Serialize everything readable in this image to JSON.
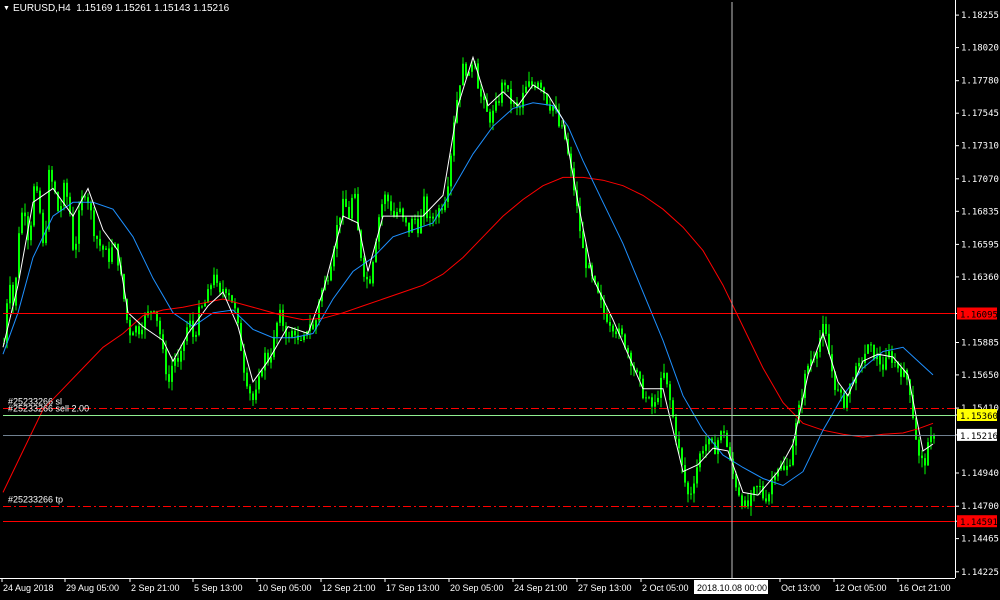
{
  "header": {
    "symbol": "EURUSD,H4",
    "ohlc": "1.15169 1.15261 1.15143 1.15216",
    "menu_icon": "triangle-down-icon"
  },
  "chart_data": {
    "type": "candlestick",
    "title": "EURUSD,H4",
    "ylim": [
      1.1418,
      1.1835
    ],
    "y_ticks": [
      "1.18255",
      "1.18020",
      "1.17780",
      "1.17545",
      "1.17310",
      "1.17070",
      "1.16835",
      "1.16595",
      "1.16360",
      "1.16095",
      "1.15885",
      "1.15650",
      "1.15410",
      "1.15360",
      "1.15216",
      "1.14940",
      "1.14700",
      "1.14591",
      "1.14465",
      "1.14225"
    ],
    "x_ticks": [
      "24 Aug 2018",
      "29 Aug 05:00",
      "2 Sep 21:00",
      "5 Sep 13:00",
      "10 Sep 05:00",
      "12 Sep 21:00",
      "17 Sep 13:00",
      "20 Sep 05:00",
      "24 Sep 21:00",
      "27 Sep 13:00",
      "2 Oct 05:00",
      "2018.10.08 00:00",
      "Oct 13:00",
      "12 Oct 05:00",
      "16 Oct 21:00"
    ],
    "crosshair_time": "2018.10.08 00:00",
    "grid": false,
    "colors": {
      "background": "#000000",
      "candle": "#00ff00",
      "fast_ma": "#ffffff",
      "mid_ma": "#1e90ff",
      "slow_ma": "#ff0000",
      "level_line": "#ff0000",
      "order_line": "#90ee90",
      "price_label_red": "#ff0000",
      "price_label_yellow": "#ffff00",
      "current_price_label": "#ffffff"
    },
    "horizontal_levels": [
      {
        "name": "resistance",
        "price": 1.16095,
        "style": "solid",
        "color": "#ff0000",
        "label": "1.16095"
      },
      {
        "name": "stop-loss",
        "price": 1.1541,
        "style": "dashdot",
        "color": "#ff0000",
        "text": "#25233266 sl"
      },
      {
        "name": "open-order",
        "price": 1.1536,
        "style": "solid",
        "color": "#90ee90",
        "text": "#25233266 sell 2.00",
        "label": "1.15360"
      },
      {
        "name": "current-price",
        "price": 1.15216,
        "style": "solid",
        "color": "#708090",
        "label": "1.15216"
      },
      {
        "name": "take-profit",
        "price": 1.147,
        "style": "dashdot",
        "color": "#ff0000",
        "text": "#25233266 tp"
      },
      {
        "name": "support",
        "price": 1.14591,
        "style": "solid",
        "color": "#ff0000",
        "label": "1.14591"
      }
    ],
    "close_path": [
      [
        0,
        1.1588
      ],
      [
        5,
        1.164
      ],
      [
        10,
        1.161
      ],
      [
        15,
        1.167
      ],
      [
        20,
        1.169
      ],
      [
        25,
        1.166
      ],
      [
        30,
        1.17
      ],
      [
        35,
        1.169
      ],
      [
        40,
        1.165
      ],
      [
        45,
        1.171
      ],
      [
        50,
        1.17
      ],
      [
        55,
        1.168
      ],
      [
        60,
        1.17
      ],
      [
        65,
        1.169
      ],
      [
        70,
        1.165
      ],
      [
        75,
        1.168
      ],
      [
        80,
        1.17
      ],
      [
        85,
        1.169
      ],
      [
        90,
        1.167
      ],
      [
        95,
        1.166
      ],
      [
        100,
        1.1655
      ],
      [
        105,
        1.165
      ],
      [
        110,
        1.166
      ],
      [
        115,
        1.1645
      ],
      [
        120,
        1.162
      ],
      [
        125,
        1.1595
      ],
      [
        130,
        1.16
      ],
      [
        135,
        1.1598
      ],
      [
        140,
        1.1605
      ],
      [
        145,
        1.161
      ],
      [
        150,
        1.1615
      ],
      [
        155,
        1.16
      ],
      [
        160,
        1.1575
      ],
      [
        165,
        1.156
      ],
      [
        170,
        1.158
      ],
      [
        175,
        1.157
      ],
      [
        180,
        1.159
      ],
      [
        185,
        1.1605
      ],
      [
        190,
        1.159
      ],
      [
        195,
        1.161
      ],
      [
        200,
        1.1615
      ],
      [
        205,
        1.1625
      ],
      [
        210,
        1.164
      ],
      [
        215,
        1.162
      ],
      [
        220,
        1.163
      ],
      [
        225,
        1.1625
      ],
      [
        230,
        1.1615
      ],
      [
        235,
        1.1595
      ],
      [
        240,
        1.157
      ],
      [
        245,
        1.1555
      ],
      [
        250,
        1.1545
      ],
      [
        255,
        1.156
      ],
      [
        260,
        1.158
      ],
      [
        265,
        1.1575
      ],
      [
        270,
        1.159
      ],
      [
        275,
        1.161
      ],
      [
        280,
        1.16
      ],
      [
        285,
        1.159
      ],
      [
        290,
        1.16
      ],
      [
        295,
        1.1585
      ],
      [
        300,
        1.159
      ],
      [
        305,
        1.1605
      ],
      [
        310,
        1.1595
      ],
      [
        315,
        1.162
      ],
      [
        320,
        1.163
      ],
      [
        325,
        1.164
      ],
      [
        330,
        1.166
      ],
      [
        335,
        1.168
      ],
      [
        340,
        1.169
      ],
      [
        345,
        1.168
      ],
      [
        350,
        1.17
      ],
      [
        355,
        1.166
      ],
      [
        360,
        1.164
      ],
      [
        365,
        1.163
      ],
      [
        370,
        1.1655
      ],
      [
        375,
        1.168
      ],
      [
        380,
        1.1695
      ],
      [
        385,
        1.169
      ],
      [
        390,
        1.168
      ],
      [
        395,
        1.1685
      ],
      [
        400,
        1.1675
      ],
      [
        405,
        1.167
      ],
      [
        410,
        1.168
      ],
      [
        415,
        1.167
      ],
      [
        420,
        1.169
      ],
      [
        425,
        1.1675
      ],
      [
        430,
        1.168
      ],
      [
        435,
        1.1685
      ],
      [
        440,
        1.169
      ],
      [
        445,
        1.171
      ],
      [
        450,
        1.175
      ],
      [
        455,
        1.1775
      ],
      [
        460,
        1.179
      ],
      [
        465,
        1.178
      ],
      [
        470,
        1.18
      ],
      [
        475,
        1.177
      ],
      [
        480,
        1.176
      ],
      [
        485,
        1.175
      ],
      [
        490,
        1.1755
      ],
      [
        495,
        1.1765
      ],
      [
        500,
        1.178
      ],
      [
        505,
        1.1765
      ],
      [
        510,
        1.176
      ],
      [
        515,
        1.1755
      ],
      [
        520,
        1.177
      ],
      [
        525,
        1.1775
      ],
      [
        530,
        1.1775
      ],
      [
        535,
        1.178
      ],
      [
        540,
        1.177
      ],
      [
        545,
        1.176
      ],
      [
        550,
        1.176
      ],
      [
        555,
        1.1745
      ],
      [
        560,
        1.174
      ],
      [
        565,
        1.172
      ],
      [
        570,
        1.17
      ],
      [
        575,
        1.1675
      ],
      [
        580,
        1.165
      ],
      [
        585,
        1.164
      ],
      [
        590,
        1.163
      ],
      [
        595,
        1.162
      ],
      [
        600,
        1.161
      ],
      [
        605,
        1.1605
      ],
      [
        610,
        1.16
      ],
      [
        615,
        1.1595
      ],
      [
        620,
        1.159
      ],
      [
        625,
        1.158
      ],
      [
        630,
        1.157
      ],
      [
        635,
        1.156
      ],
      [
        640,
        1.155
      ],
      [
        645,
        1.1545
      ],
      [
        650,
        1.154
      ],
      [
        655,
        1.1555
      ],
      [
        660,
        1.1565
      ],
      [
        665,
        1.155
      ],
      [
        670,
        1.153
      ],
      [
        675,
        1.151
      ],
      [
        680,
        1.149
      ],
      [
        685,
        1.1475
      ],
      [
        690,
        1.149
      ],
      [
        695,
        1.1505
      ],
      [
        700,
        1.1515
      ],
      [
        705,
        1.1515
      ],
      [
        710,
        1.151
      ],
      [
        715,
        1.152
      ],
      [
        720,
        1.1525
      ],
      [
        725,
        1.1505
      ],
      [
        730,
        1.149
      ],
      [
        735,
        1.148
      ],
      [
        740,
        1.147
      ],
      [
        745,
        1.147
      ],
      [
        750,
        1.148
      ],
      [
        755,
        1.1485
      ],
      [
        760,
        1.1475
      ],
      [
        765,
        1.148
      ],
      [
        770,
        1.1495
      ],
      [
        775,
        1.15
      ],
      [
        780,
        1.1495
      ],
      [
        785,
        1.15
      ],
      [
        790,
        1.152
      ],
      [
        795,
        1.154
      ],
      [
        800,
        1.156
      ],
      [
        805,
        1.1575
      ],
      [
        810,
        1.158
      ],
      [
        815,
        1.159
      ],
      [
        820,
        1.16
      ],
      [
        825,
        1.158
      ],
      [
        830,
        1.156
      ],
      [
        835,
        1.155
      ],
      [
        840,
        1.1545
      ],
      [
        845,
        1.1555
      ],
      [
        850,
        1.1565
      ],
      [
        855,
        1.157
      ],
      [
        860,
        1.158
      ],
      [
        865,
        1.1585
      ],
      [
        870,
        1.158
      ],
      [
        875,
        1.1575
      ],
      [
        880,
        1.157
      ],
      [
        885,
        1.158
      ],
      [
        890,
        1.1575
      ],
      [
        895,
        1.157
      ],
      [
        900,
        1.1565
      ],
      [
        905,
        1.156
      ],
      [
        910,
        1.153
      ],
      [
        915,
        1.1505
      ],
      [
        920,
        1.15
      ],
      [
        925,
        1.1515
      ],
      [
        930,
        1.1522
      ]
    ],
    "fast_ma_path": [
      [
        0,
        1.1585
      ],
      [
        15,
        1.163
      ],
      [
        30,
        1.169
      ],
      [
        50,
        1.17
      ],
      [
        70,
        1.168
      ],
      [
        85,
        1.17
      ],
      [
        100,
        1.167
      ],
      [
        115,
        1.1655
      ],
      [
        125,
        1.161
      ],
      [
        140,
        1.16
      ],
      [
        160,
        1.159
      ],
      [
        170,
        1.1575
      ],
      [
        185,
        1.1595
      ],
      [
        205,
        1.1615
      ],
      [
        220,
        1.1625
      ],
      [
        235,
        1.16
      ],
      [
        250,
        1.156
      ],
      [
        265,
        1.1575
      ],
      [
        285,
        1.16
      ],
      [
        305,
        1.1595
      ],
      [
        320,
        1.1625
      ],
      [
        340,
        1.168
      ],
      [
        355,
        1.1675
      ],
      [
        365,
        1.164
      ],
      [
        380,
        1.168
      ],
      [
        400,
        1.168
      ],
      [
        420,
        1.168
      ],
      [
        440,
        1.1695
      ],
      [
        455,
        1.176
      ],
      [
        470,
        1.1795
      ],
      [
        485,
        1.176
      ],
      [
        500,
        1.177
      ],
      [
        515,
        1.176
      ],
      [
        530,
        1.1775
      ],
      [
        545,
        1.1768
      ],
      [
        560,
        1.175
      ],
      [
        575,
        1.169
      ],
      [
        590,
        1.1635
      ],
      [
        610,
        1.1605
      ],
      [
        625,
        1.158
      ],
      [
        640,
        1.1555
      ],
      [
        660,
        1.1555
      ],
      [
        680,
        1.1495
      ],
      [
        695,
        1.15
      ],
      [
        710,
        1.1512
      ],
      [
        725,
        1.151
      ],
      [
        740,
        1.148
      ],
      [
        755,
        1.1478
      ],
      [
        775,
        1.1495
      ],
      [
        790,
        1.1515
      ],
      [
        805,
        1.1565
      ],
      [
        820,
        1.1595
      ],
      [
        835,
        1.156
      ],
      [
        845,
        1.155
      ],
      [
        860,
        1.1575
      ],
      [
        875,
        1.158
      ],
      [
        890,
        1.1578
      ],
      [
        905,
        1.1565
      ],
      [
        920,
        1.151
      ],
      [
        930,
        1.1515
      ]
    ],
    "mid_ma_path": [
      [
        0,
        1.158
      ],
      [
        15,
        1.161
      ],
      [
        30,
        1.165
      ],
      [
        50,
        1.168
      ],
      [
        70,
        1.169
      ],
      [
        90,
        1.169
      ],
      [
        110,
        1.1685
      ],
      [
        130,
        1.1665
      ],
      [
        150,
        1.1635
      ],
      [
        170,
        1.161
      ],
      [
        190,
        1.16
      ],
      [
        210,
        1.161
      ],
      [
        230,
        1.1612
      ],
      [
        250,
        1.1598
      ],
      [
        270,
        1.1592
      ],
      [
        290,
        1.1592
      ],
      [
        310,
        1.1595
      ],
      [
        330,
        1.162
      ],
      [
        350,
        1.164
      ],
      [
        370,
        1.165
      ],
      [
        390,
        1.1665
      ],
      [
        410,
        1.167
      ],
      [
        430,
        1.1675
      ],
      [
        450,
        1.17
      ],
      [
        470,
        1.1725
      ],
      [
        490,
        1.1745
      ],
      [
        510,
        1.1758
      ],
      [
        530,
        1.1762
      ],
      [
        550,
        1.176
      ],
      [
        565,
        1.1745
      ],
      [
        580,
        1.172
      ],
      [
        600,
        1.169
      ],
      [
        620,
        1.166
      ],
      [
        640,
        1.1625
      ],
      [
        660,
        1.159
      ],
      [
        680,
        1.155
      ],
      [
        700,
        1.1525
      ],
      [
        720,
        1.1507
      ],
      [
        740,
        1.1498
      ],
      [
        760,
        1.149
      ],
      [
        780,
        1.1485
      ],
      [
        800,
        1.1495
      ],
      [
        820,
        1.1525
      ],
      [
        840,
        1.155
      ],
      [
        860,
        1.157
      ],
      [
        880,
        1.1582
      ],
      [
        900,
        1.1585
      ],
      [
        915,
        1.1575
      ],
      [
        930,
        1.1565
      ]
    ],
    "slow_ma_path": [
      [
        0,
        1.148
      ],
      [
        20,
        1.151
      ],
      [
        40,
        1.154
      ],
      [
        60,
        1.1555
      ],
      [
        80,
        1.157
      ],
      [
        100,
        1.1585
      ],
      [
        120,
        1.1595
      ],
      [
        140,
        1.1608
      ],
      [
        160,
        1.1612
      ],
      [
        180,
        1.1614
      ],
      [
        200,
        1.1617
      ],
      [
        220,
        1.162
      ],
      [
        240,
        1.1616
      ],
      [
        260,
        1.1612
      ],
      [
        280,
        1.1608
      ],
      [
        300,
        1.1605
      ],
      [
        320,
        1.1606
      ],
      [
        340,
        1.161
      ],
      [
        360,
        1.1615
      ],
      [
        380,
        1.162
      ],
      [
        400,
        1.1625
      ],
      [
        420,
        1.163
      ],
      [
        440,
        1.1638
      ],
      [
        460,
        1.165
      ],
      [
        480,
        1.1665
      ],
      [
        500,
        1.168
      ],
      [
        520,
        1.1692
      ],
      [
        540,
        1.1702
      ],
      [
        560,
        1.1708
      ],
      [
        580,
        1.1708
      ],
      [
        600,
        1.1706
      ],
      [
        620,
        1.1702
      ],
      [
        640,
        1.1695
      ],
      [
        660,
        1.1685
      ],
      [
        680,
        1.1672
      ],
      [
        700,
        1.1655
      ],
      [
        720,
        1.163
      ],
      [
        740,
        1.16
      ],
      [
        760,
        1.157
      ],
      [
        780,
        1.1545
      ],
      [
        800,
        1.153
      ],
      [
        820,
        1.1525
      ],
      [
        840,
        1.1522
      ],
      [
        860,
        1.152
      ],
      [
        880,
        1.1522
      ],
      [
        900,
        1.1523
      ],
      [
        915,
        1.1526
      ],
      [
        930,
        1.153
      ]
    ]
  }
}
